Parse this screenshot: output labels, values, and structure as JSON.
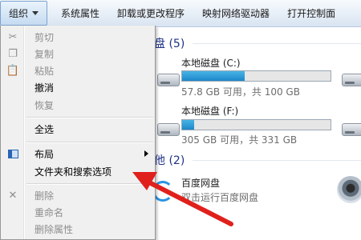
{
  "toolbar": {
    "organize": "组织",
    "system_properties": "系统属性",
    "uninstall": "卸载或更改程序",
    "map_drive": "映射网络驱动器",
    "control_panel": "打开控制面"
  },
  "sections": {
    "hard_drives_header_partial": "盘 (5)",
    "other_header_partial": "他 (2)"
  },
  "drives": [
    {
      "name": "本地磁盘 (C:)",
      "size_text": "57.8 GB 可用，共 100 GB",
      "used_fraction": 0.42
    },
    {
      "name": "本地磁盘 (F:)",
      "size_text": "305 GB 可用，共 331 GB",
      "used_fraction": 0.08
    }
  ],
  "other": {
    "baidu_name": "百度网盘",
    "baidu_desc": "双击运行百度网盘"
  },
  "menu": {
    "cut": "剪切",
    "copy": "复制",
    "paste": "粘贴",
    "undo": "撤消",
    "redo": "恢复",
    "select_all": "全选",
    "layout": "布局",
    "folder_options": "文件夹和搜索选项",
    "delete": "删除",
    "rename": "重命名",
    "remove_properties": "删除属性"
  },
  "colors": {
    "annotation_arrow": "#e0201c",
    "section_header": "#1e3287",
    "drive_fill": "#2596d6"
  }
}
